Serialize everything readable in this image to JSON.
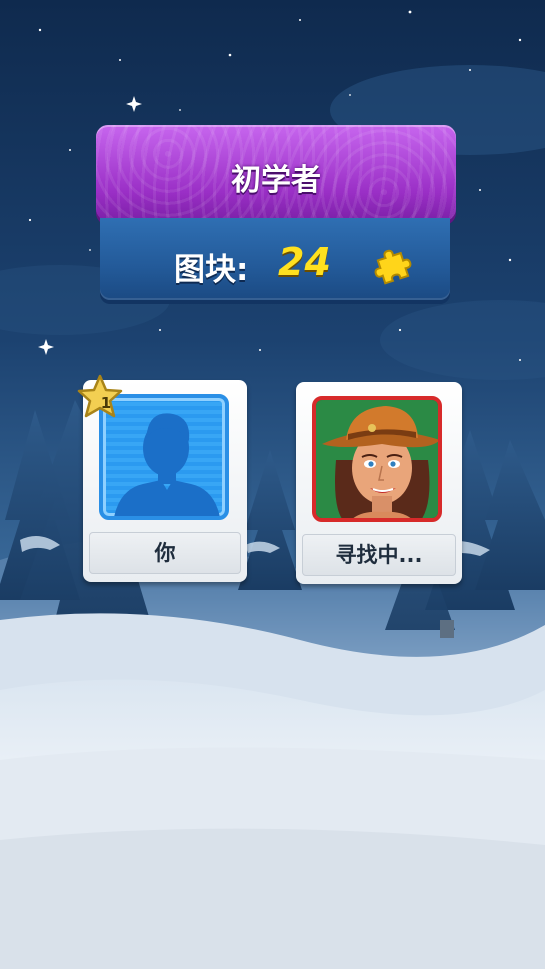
{
  "level": {
    "title": "初学者"
  },
  "pieces": {
    "label": "图块:",
    "value": "24",
    "icon": "puzzle-piece-icon"
  },
  "players": {
    "you": {
      "name": "你",
      "rank": "1",
      "avatar": "silhouette-avatar-icon",
      "frame_color": "#2a8fe6"
    },
    "opponent": {
      "name": "寻找中...",
      "avatar": "cowgirl-avatar",
      "frame_color": "#d72a2a"
    }
  },
  "colors": {
    "sky": "#1e3f6b",
    "banner": "#a23ad0",
    "panel": "#235a99",
    "pieces_value": "#ffe11f"
  }
}
